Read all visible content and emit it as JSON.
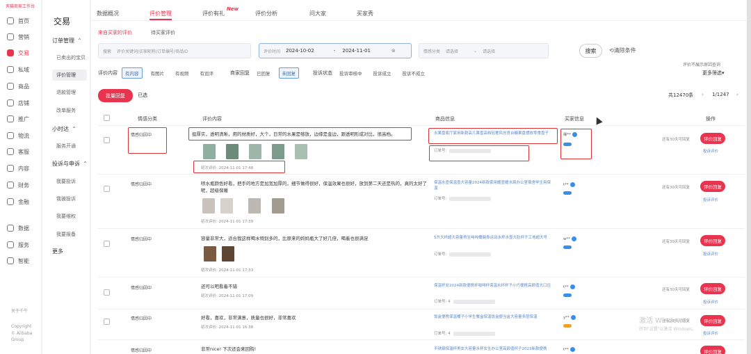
{
  "rail": {
    "brand": "天猫商家工作台",
    "items": [
      "首页",
      "营销",
      "交易",
      "私域",
      "商品",
      "店铺",
      "推广",
      "物流",
      "客服",
      "内容",
      "财务",
      "金融",
      "数据",
      "服务",
      "智能"
    ],
    "active_index": 2,
    "foot1": "关于千牛",
    "foot2": "Copyright",
    "foot3": "© Alibaba",
    "foot4": "Group"
  },
  "menu": {
    "title": "交易",
    "group_order": "订单管理",
    "item_sold": "已卖出的宝贝",
    "item_review": "评价管理",
    "item_refund": "退款管理",
    "item_modify": "改单服务",
    "group_xiaoshida": "小时达",
    "item_service_open": "服务开通",
    "group_complaint": "投诉与申诉",
    "item_my_complaint": "我要投诉",
    "item_my_appeal": "我被投诉",
    "item_my_report": "我要维权",
    "item_my_report2": "我要报备",
    "more": "更多"
  },
  "tabs": [
    "数据概况",
    "评价管理",
    "评价有礼",
    "评价分析",
    "问大家",
    "买家秀"
  ],
  "tab_new_badge": "New",
  "subtabs": [
    "来自买家的评价",
    "待买家评价"
  ],
  "search": {
    "keyword_label": "搜索",
    "keyword_placeholder": "评价关键词/买家昵称/订单编号/商品ID",
    "time_label": "评价时间",
    "date_from": "2024-10-02",
    "date_sep": "-",
    "date_to": "2024-11-01",
    "emotion_label": "情感分类",
    "emotion_select1": "请选择",
    "emotion_select2": "请选择",
    "search_button": "搜索",
    "clear_button": "清除条件"
  },
  "filters": {
    "content_label": "评价内容",
    "content_opts": [
      "有内容",
      "有图片",
      "有视频",
      "有追评"
    ],
    "reply_label": "商家回复",
    "reply_opts": [
      "已回复",
      "未回复"
    ],
    "status_label": "投诉状态",
    "status_opts": [
      "投诉审核中",
      "投诉成立",
      "投诉不成立"
    ],
    "hint": "评价不展示原因查询",
    "more_filter": "更多筛选"
  },
  "bulk": {
    "reply_button": "批量回复",
    "select_all": "已选",
    "total": "共12470条",
    "page": "1/1247"
  },
  "columns": [
    "情感分类",
    "评价内容",
    "商品信息",
    "买家信息",
    "操作"
  ],
  "rows": [
    {
      "emotion": "情感归因中",
      "review": "挺厚实，透明清晰，用的材质好，大个，日常的水果是够放，边缘是金边，跟透明形成对比，很高档。",
      "date": "初次评价: 2024-11-01 17:48",
      "product": "水果盘客厅家用新款高几果盘高档轻奢风创意台糖果盘摆放零食盘子",
      "order": "订单号:",
      "buyer": "缘**",
      "note": "还有30天可回复",
      "reply": "评价回复",
      "op": "投诉评价"
    },
    {
      "emotion": "情感归因中",
      "review": "喷水瓶颜色好看，把手的地方是加宽加厚的，细节做得很好，保温效果也很好，放到第二天还是热的，真的太好了呢，超级保暖",
      "date": "初次评价: 2024-11-01 17:39",
      "product": "保温水壶保温壶大容量2024新款家用暖壶暖水瓶办公室宿舍学生用保温",
      "order": "订单号:",
      "buyer": "t**",
      "note": "还有30天可回复",
      "reply": "评价回复",
      "op": "投诉评价"
    },
    {
      "emotion": "情感归因中",
      "review": "容量非常大，适合我这样喝水特别多的，比原来的妈妈瓶大了好几倍，喝着也很满足",
      "date": "初次评价: 2024-11-01 17:33",
      "product": "5升大杯超大容量男生吨吨桶健身运动水杯水壶大肚杯子工地超大号",
      "order": "订单号:",
      "buyer": "w**",
      "note": "还有30天可回复",
      "reply": "评价回复",
      "op": "投诉评价"
    },
    {
      "emotion": "情感归因中",
      "review": "还可以吧看着不错",
      "date": "初次评价: 2024-11-01 17:09",
      "product": "保温杯女2024新款便携杯咖啡杯保温水杯杯子小巧便携高颜值大口径",
      "order": "订单号: 4",
      "buyer": "t**",
      "note": "还有30天可回复",
      "reply": "评价回复",
      "op": "投诉评价"
    },
    {
      "emotion": "情感归因中",
      "review": "好看，喜欢，非常满意，质量也很好，非常喜欢",
      "date": "初次评价: 2024-11-01 16:38",
      "product": "饭盒便携保温桶子小学生餐盒保温饭盒便当盒大容量多层保温",
      "order": "订单号: 4",
      "buyer": "y**",
      "note": "还有30天可回复",
      "reply": "评价回复",
      "op": "投诉评价"
    },
    {
      "emotion": "情感归因中",
      "review": "非常nice! 下次还会来回购!",
      "date": "",
      "product": "不锈钢保温杯男女大容量水杯女生办公室高颜值杯子2023新款便携",
      "order": "",
      "buyer": "t**",
      "note": "",
      "reply": "评价回复",
      "op": ""
    }
  ],
  "watermark": {
    "line1": "激活 Windows",
    "line2": "转到\"设置\"以激活 Windows。"
  }
}
